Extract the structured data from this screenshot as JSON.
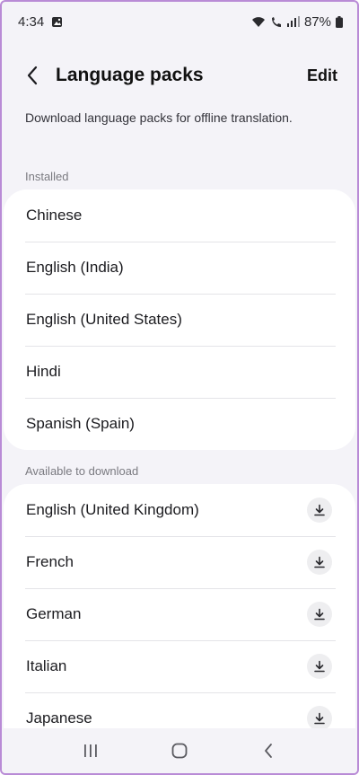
{
  "status_bar": {
    "time": "4:34",
    "battery": "87%",
    "icons": [
      "gallery-icon",
      "wifi-icon",
      "wifi-call-icon",
      "signal-icon",
      "battery-icon"
    ]
  },
  "header": {
    "title": "Language packs",
    "edit_label": "Edit",
    "back_icon": "back-arrow-icon"
  },
  "subtitle": "Download language packs for offline translation.",
  "installed": {
    "label": "Installed",
    "items": [
      {
        "label": "Chinese"
      },
      {
        "label": "English (India)"
      },
      {
        "label": "English (United States)"
      },
      {
        "label": "Hindi"
      },
      {
        "label": "Spanish (Spain)"
      }
    ]
  },
  "available": {
    "label": "Available to download",
    "items": [
      {
        "label": "English (United Kingdom)",
        "icon": "download-icon"
      },
      {
        "label": "French",
        "icon": "download-icon"
      },
      {
        "label": "German",
        "icon": "download-icon"
      },
      {
        "label": "Italian",
        "icon": "download-icon"
      },
      {
        "label": "Japanese",
        "icon": "download-icon"
      }
    ]
  },
  "nav_bar": {
    "buttons": [
      "recent-apps-icon",
      "home-icon",
      "back-icon"
    ]
  },
  "colors": {
    "background": "#f4f3f8",
    "card": "#ffffff",
    "frame": "#b98bd6"
  }
}
